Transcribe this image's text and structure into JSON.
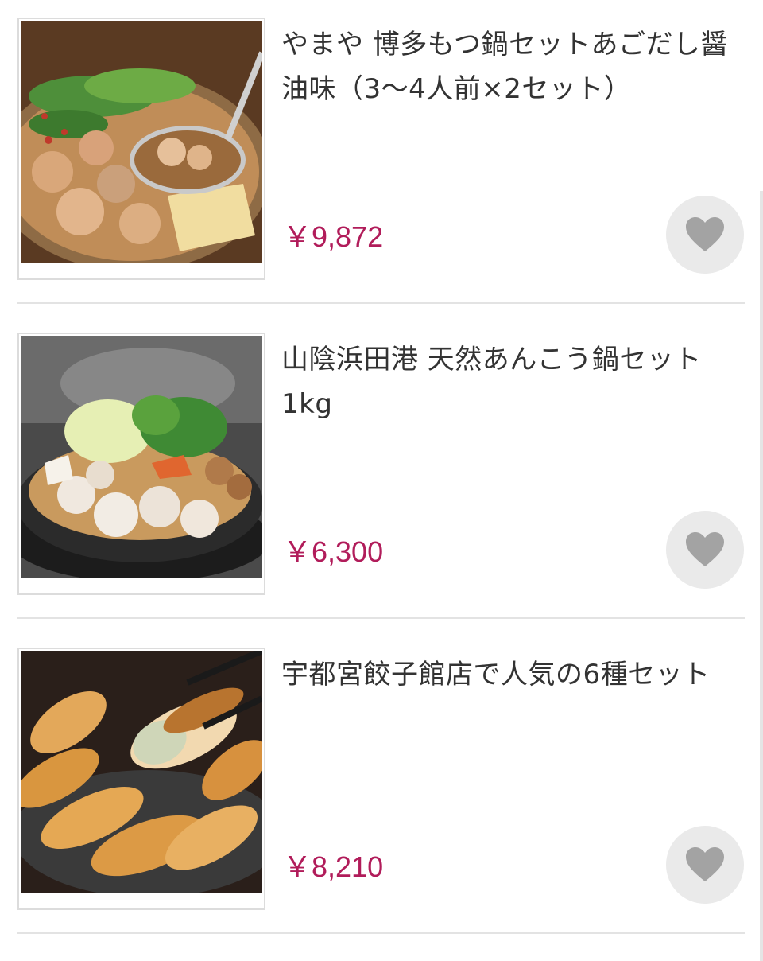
{
  "products": [
    {
      "title": "やまや 博多もつ鍋セットあごだし醤油味（3〜4人前×2セット）",
      "price": "￥9,872",
      "image_alt": "博多もつ鍋"
    },
    {
      "title": "山陰浜田港 天然あんこう鍋セット 1kg",
      "price": "￥6,300",
      "image_alt": "あんこう鍋"
    },
    {
      "title": "宇都宮餃子館店で人気の6種セット",
      "price": "￥8,210",
      "image_alt": "宇都宮餃子"
    }
  ],
  "icons": {
    "favorite": "heart-icon"
  },
  "colors": {
    "price": "#b11c5a",
    "fav_bg": "#eaeaea",
    "fav_icon": "#a3a3a3",
    "divider": "#e3e3e3"
  }
}
